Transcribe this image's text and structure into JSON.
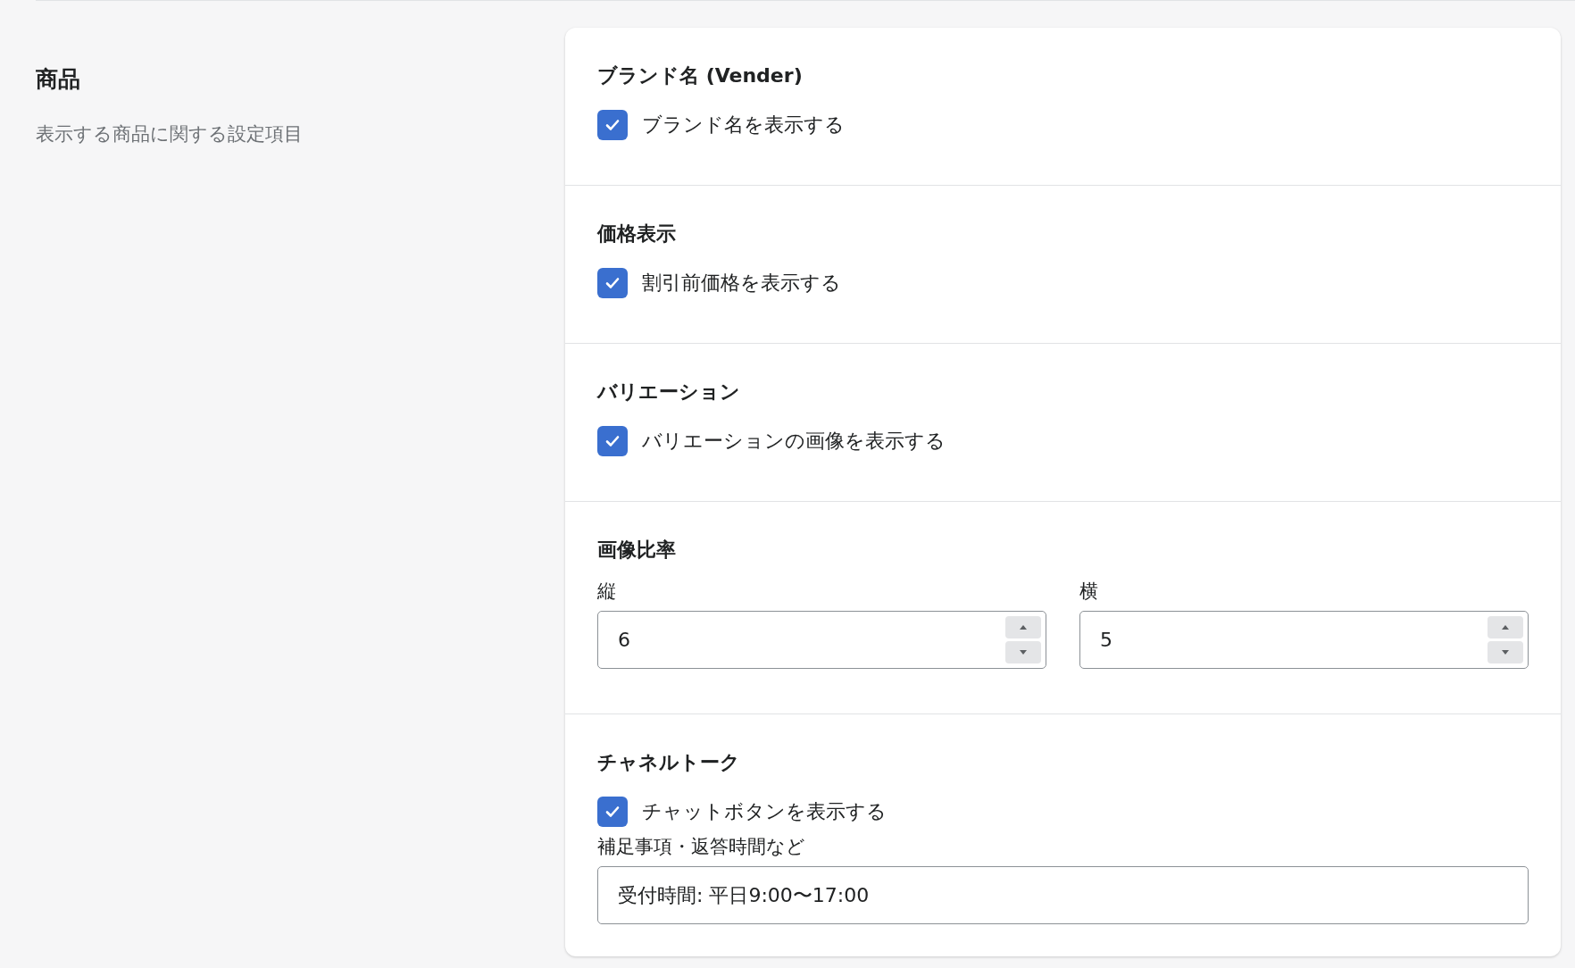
{
  "section": {
    "title": "商品",
    "description": "表示する商品に関する設定項目"
  },
  "groups": [
    {
      "kind": "checkbox",
      "title": "ブランド名 (Vender)",
      "checkbox": {
        "label": "ブランド名を表示する",
        "checked": true
      }
    },
    {
      "kind": "checkbox",
      "title": "価格表示",
      "checkbox": {
        "label": "割引前価格を表示する",
        "checked": true
      }
    },
    {
      "kind": "checkbox",
      "title": "バリエーション",
      "checkbox": {
        "label": "バリエーションの画像を表示する",
        "checked": true
      }
    },
    {
      "kind": "ratio",
      "title": "画像比率",
      "fields": [
        {
          "label": "縦",
          "value": "6"
        },
        {
          "label": "横",
          "value": "5"
        }
      ]
    },
    {
      "kind": "chat",
      "title": "チャネルトーク",
      "checkbox": {
        "label": "チャットボタンを表示する",
        "checked": true
      },
      "note_label": "補足事項・返答時間など",
      "note_value": "受付時間: 平日9:00〜17:00"
    }
  ]
}
